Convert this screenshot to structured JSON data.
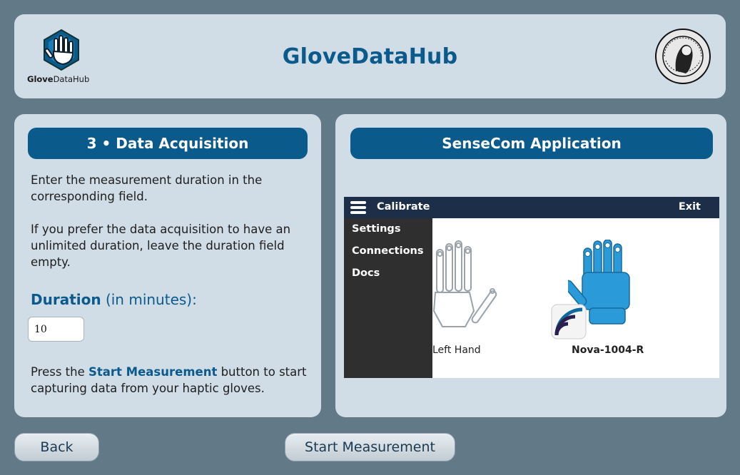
{
  "app": {
    "title": "GloveDataHub",
    "logo_text_bold": "Glove",
    "logo_text_rest": "DataHub"
  },
  "left_panel": {
    "title": "3 • Data Acquisition",
    "para1": "Enter the measurement duration in the corresponding field.",
    "para2": "If you prefer the data acquisition to have an unlimited duration, leave the duration field empty.",
    "duration_label": "Duration",
    "duration_suffix": " (in minutes):",
    "duration_value": "10",
    "para3_prefix": "Press the ",
    "para3_highlight": "Start Measurement",
    "para3_suffix": " button to start capturing data from your haptic gloves."
  },
  "right_panel": {
    "title": "SenseCom Application",
    "screenshot": {
      "top_title": "Calibrate",
      "exit": "Exit",
      "menu": [
        "Settings",
        "Connections",
        "Docs"
      ],
      "left_hand_label": "Left Hand",
      "right_hand_label": "Nova-1004-R"
    }
  },
  "footer": {
    "back_label": "Back",
    "start_label": "Start Measurement"
  },
  "colors": {
    "background": "#627987",
    "panel": "#d0dce6",
    "accent": "#0a5a8c",
    "glove_blue": "#2a9ad8"
  }
}
